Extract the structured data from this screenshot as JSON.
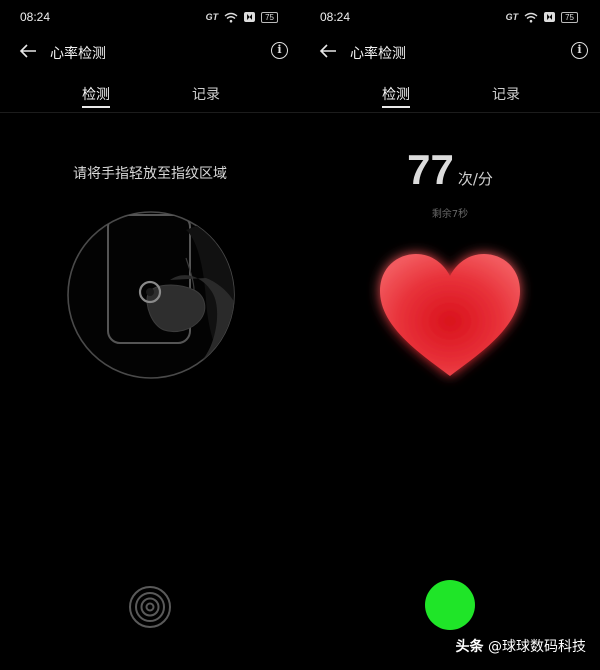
{
  "status_bar": {
    "time": "08:24",
    "carrier_badge": "GT",
    "battery": "75"
  },
  "header": {
    "title": "心率检测",
    "info_glyph": "i"
  },
  "tabs": [
    {
      "label": "检测",
      "active": true
    },
    {
      "label": "记录",
      "active": false
    }
  ],
  "left_screen": {
    "instruction": "请将手指轻放至指纹区域"
  },
  "right_screen": {
    "bpm_value": "77",
    "bpm_unit": "次/分",
    "remaining": "剩余7秒"
  },
  "watermark": {
    "brand": "头条",
    "handle": "@球球数码科技"
  },
  "colors": {
    "background": "#000000",
    "heart": "#e8232a",
    "status_dot": "#1fe528",
    "text": "#e8e8e8"
  },
  "icons": {
    "back": "arrow-left-icon",
    "info": "info-icon",
    "wifi": "wifi-icon",
    "fingerprint": "fingerprint-icon"
  }
}
